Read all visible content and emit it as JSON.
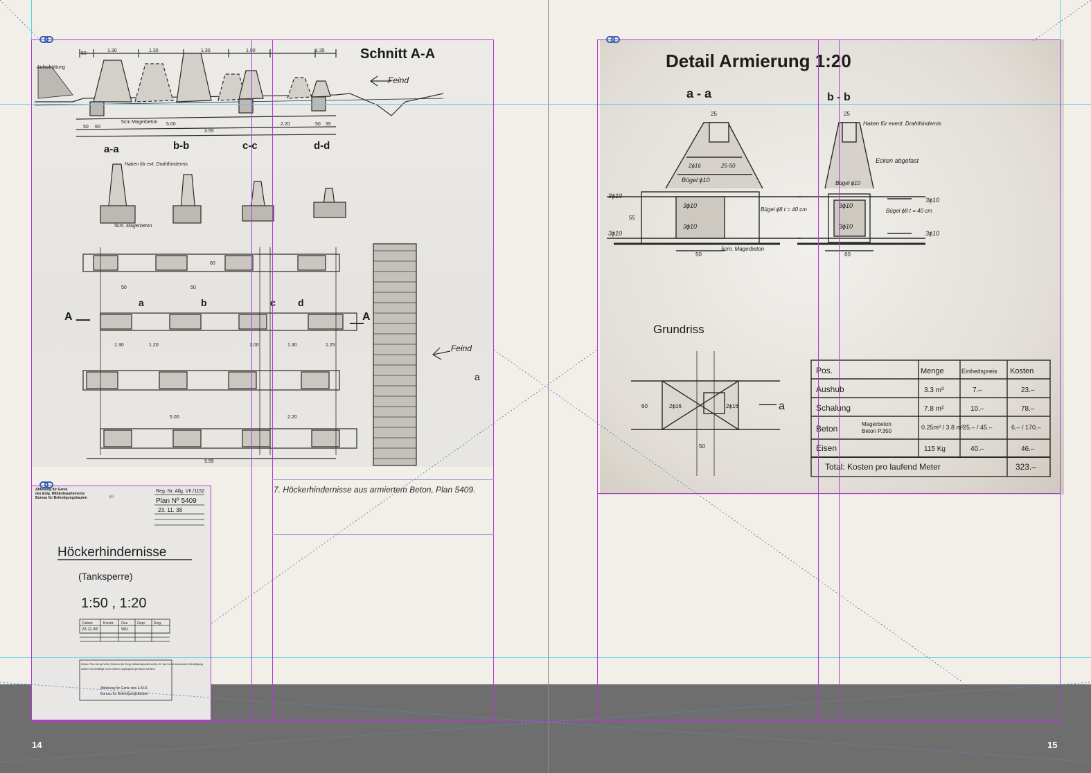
{
  "left_page": {
    "page_number": "14",
    "drawing": {
      "title": "Schnitt A-A",
      "feind_top": "Feind",
      "feind_plan": "Feind",
      "aufschuettung": "Aufschüttung",
      "section_labels": [
        "a-a",
        "b-b",
        "c-c",
        "d-d"
      ],
      "marker_a_left": "A",
      "marker_a_right": "A",
      "marker_small_a": "a",
      "haken_note": "Haken für evt. Drahthindernis",
      "magerbeton_note": "5cm. Magerbeton",
      "magerbeton_profile": "5cm Magerbeton",
      "dims_top": [
        "50",
        "1.30",
        "1.30",
        "1.30",
        "1.00",
        "1.35"
      ],
      "dims_bottom": [
        "50",
        "60",
        "5.00",
        "2.20",
        "50",
        "35",
        "3.55"
      ],
      "plan_dims": [
        "50",
        "50",
        "1.30",
        "1.20",
        "1.00",
        "1.30",
        "1.25",
        "5.00",
        "2.20",
        "9.55",
        "60"
      ],
      "section_letters": [
        "a",
        "b",
        "c",
        "d"
      ]
    },
    "title_card": {
      "header_lines": [
        "Abteilung für Genie",
        "des Eidg. Militärdepartements",
        "Bureau für Befestigungsbauten"
      ],
      "roman": "VII",
      "reg": "Reg. Nr. Allg. VII./1152",
      "plan_no": "Plan Nº 5409",
      "plan_date": "23. 11. 38",
      "title": "Höckerhindernisse",
      "subtitle": "(Tanksperre)",
      "scale": "1:50 , 1:20",
      "table_headers": [
        "Datum",
        "Konstr.",
        "Gez.",
        "Gepr.",
        "Eing."
      ],
      "table_row": [
        "23.11.38",
        "",
        "Wd.",
        "",
        ""
      ],
      "footer_lines": [
        "Dieser Plan ist geheim (Sektion der Eidg. Militärdepartements). Er darf ohne besondere Bewilligung",
        "weder vervielfältigt noch Dritten zugänglich gemacht werden.",
        "Abteilung für Genie des E.M.D.",
        "Bureau für Befestigungsbauten"
      ]
    },
    "caption": "7. Höckerhindernisse aus armiertem Beton, Plan 5409."
  },
  "right_page": {
    "page_number": "15",
    "drawing": {
      "title": "Detail Armierung 1:20",
      "section_aa": "a - a",
      "section_bb": "b - b",
      "haken_note": "Haken für event. Drahthindernis",
      "ecken_note": "Ecken abgefast",
      "buegel_10": "Bügel ϕ10",
      "buegel_8": "Bügel ϕ8 t = 40 cm",
      "rebar_2x16": "2ϕ16",
      "rebar_3x10": "3ϕ10",
      "dim_25": "25",
      "dim_50": "50",
      "dim_60": "60",
      "dim_55": "55",
      "dim_2550": "25-50",
      "magerbeton": "5cm. Magerbeton",
      "grundriss": "Grundriss",
      "marker_a": "a",
      "cost_table": {
        "headers": [
          "Pos.",
          "Menge",
          "Einheitspreis",
          "Kosten"
        ],
        "rows": [
          [
            "Aushub",
            "3.3 m³",
            "7.–",
            "23.–"
          ],
          [
            "Schalung",
            "7.8 m²",
            "10.–",
            "78.–"
          ],
          [
            "Beton",
            "0.25m³ / 3.8 m³",
            "25.– / 45.–",
            "6.– / 170.–"
          ],
          [
            "Eisen",
            "115 Kg",
            "40.–",
            "46.–"
          ]
        ],
        "beton_sub": [
          "Magerbeton",
          "Beton P.350"
        ],
        "total_label": "Total: Kosten pro laufend Meter",
        "total_value": "323.–"
      }
    }
  },
  "colors": {
    "page": "#f2eee8",
    "pasteboard": "#6f6e6e",
    "frame": "#b13ad1",
    "guide": "#56d2e6",
    "ink": "#1c1c1c"
  },
  "icons": [
    "link-chain-icon"
  ]
}
